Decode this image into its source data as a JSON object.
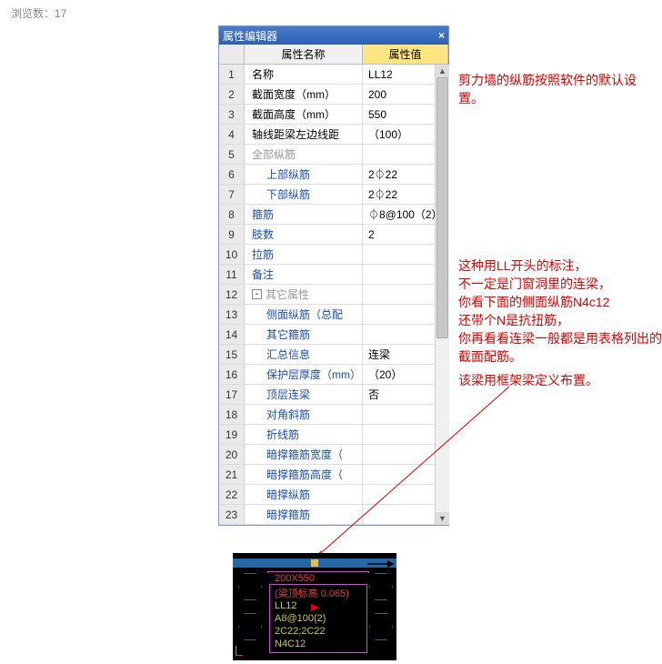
{
  "viewCount": "浏览数：17",
  "panel": {
    "title": "属性编辑器",
    "colName": "属性名称",
    "colVal": "属性值",
    "rows": [
      {
        "n": "1",
        "name": "名称",
        "val": "LL12"
      },
      {
        "n": "2",
        "name": "截面宽度（mm）",
        "val": "200"
      },
      {
        "n": "3",
        "name": "截面高度（mm）",
        "val": "550"
      },
      {
        "n": "4",
        "name": "轴线距梁左边线距",
        "val": "（100）"
      },
      {
        "n": "5",
        "name": "全部纵筋",
        "val": "",
        "grayName": true
      },
      {
        "n": "6",
        "name": "上部纵筋",
        "val": "2⏀22",
        "blue": true,
        "indent": true
      },
      {
        "n": "7",
        "name": "下部纵筋",
        "val": "2⏀22",
        "blue": true,
        "indent": true
      },
      {
        "n": "8",
        "name": "箍筋",
        "val": "⏀8@100（2）",
        "blue": true
      },
      {
        "n": "9",
        "name": "肢数",
        "val": "2",
        "blue": true
      },
      {
        "n": "10",
        "name": "拉筋",
        "val": "",
        "blue": true
      },
      {
        "n": "11",
        "name": "备注",
        "val": "",
        "blue": true
      },
      {
        "n": "12",
        "name": "其它属性",
        "val": "",
        "gray": true,
        "expand": true
      },
      {
        "n": "13",
        "name": "侧面纵筋（总配",
        "val": "",
        "blue": true,
        "indent": true
      },
      {
        "n": "14",
        "name": "其它箍筋",
        "val": "",
        "blue": true,
        "indent": true
      },
      {
        "n": "15",
        "name": "汇总信息",
        "val": "连梁",
        "blue": true,
        "indent": true
      },
      {
        "n": "16",
        "name": "保护层厚度（mm）",
        "val": "（20）",
        "blue": true,
        "indent": true
      },
      {
        "n": "17",
        "name": "顶层连梁",
        "val": "否",
        "blue": true,
        "indent": true
      },
      {
        "n": "18",
        "name": "对角斜筋",
        "val": "",
        "blue": true,
        "indent": true
      },
      {
        "n": "19",
        "name": "折线筋",
        "val": "",
        "blue": true,
        "indent": true
      },
      {
        "n": "20",
        "name": "暗撑箍筋宽度（",
        "val": "",
        "blue": true,
        "indent": true
      },
      {
        "n": "21",
        "name": "暗撑箍筋高度（",
        "val": "",
        "blue": true,
        "indent": true
      },
      {
        "n": "22",
        "name": "暗撑纵筋",
        "val": "",
        "blue": true,
        "indent": true
      },
      {
        "n": "23",
        "name": "暗撑箍筋",
        "val": "",
        "blue": true,
        "indent": true
      }
    ]
  },
  "annotations": {
    "a1": "剪力墙的纵筋按照软件的默认设置。",
    "a2": "这种用LL开头的标注，\n不一定是门窗洞里的连梁，\n你看下面的侧面纵筋N4c12\n还带个N是抗扭筋，\n你再看看连梁一般都是用表格列出的截面配筋。",
    "a3": "该梁用框架梁定义布置。"
  },
  "cad": {
    "l1": "200X550",
    "l2": "(梁顶标高 0.065)",
    "l3": "LL12",
    "l4": "A8@100(2)",
    "l5": "2C22;2C22",
    "l6": "N4C12"
  }
}
